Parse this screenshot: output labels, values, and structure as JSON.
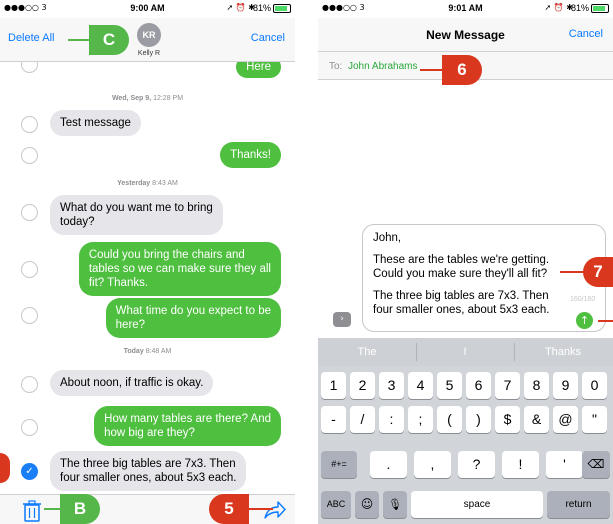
{
  "left": {
    "status": {
      "carrier": "●●●○○ 3",
      "time": "9:00 AM",
      "icons": "➚ ⏰ ✱",
      "battery": "81%"
    },
    "header": {
      "delete_all": "Delete All",
      "avatar_initials": "KR",
      "contact_name": "Kelly R",
      "cancel": "Cancel"
    },
    "messages": [
      {
        "text": "Here"
      },
      {
        "stamp_day": "Wed, Sep 9,",
        "stamp_time": "12:28 PM"
      },
      {
        "text": "Test message"
      },
      {
        "text": "Thanks!"
      },
      {
        "stamp_day": "Yesterday",
        "stamp_time": "8:43 AM"
      },
      {
        "line1": "What do you want me to bring",
        "line2": "today?"
      },
      {
        "line1": "Could you bring the chairs and",
        "line2": "tables so we can make sure they all",
        "line3": "fit? Thanks."
      },
      {
        "line1": "What time do you expect to be",
        "line2": "here?"
      },
      {
        "stamp_day": "Today",
        "stamp_time": "8:48 AM"
      },
      {
        "text": "About noon, if traffic is okay."
      },
      {
        "line1": "How many tables are there? And",
        "line2": "how big are they?"
      },
      {
        "line1": "The three big tables are 7x3. Then",
        "line2": "four smaller ones, about 5x3 each."
      }
    ],
    "callouts": {
      "c": "C",
      "b": "B",
      "five": "5"
    }
  },
  "right": {
    "status": {
      "carrier": "●●●○○ 3",
      "time": "9:01 AM",
      "icons": "➚ ⏰ ✱",
      "battery": "81%"
    },
    "header": {
      "title": "New Message",
      "cancel": "Cancel"
    },
    "to": {
      "label": "To:",
      "recipient": "John Abrahams"
    },
    "compose": {
      "greeting": "John,",
      "para1_line1": "These are the tables we're getting.",
      "para1_line2": "Could you make sure they'll all fit?",
      "para2_line1": "The three big tables are 7x3. Then",
      "para2_line2": "four smaller ones, about 5x3 each.",
      "char_count": "160/160"
    },
    "suggestions": [
      "The",
      "I",
      "Thanks"
    ],
    "keys": {
      "row1": [
        "1",
        "2",
        "3",
        "4",
        "5",
        "6",
        "7",
        "8",
        "9",
        "0"
      ],
      "row2": [
        "-",
        "/",
        ":",
        ";",
        "(",
        ")",
        "$",
        "&",
        "@",
        "\""
      ],
      "row3_left": "#+=",
      "row3": [
        ".",
        ",",
        "?",
        "!",
        "'"
      ],
      "row4_left": "ABC",
      "space": "space",
      "return": "return"
    },
    "callouts": {
      "six": "6",
      "seven": "7"
    }
  },
  "colors": {
    "imessage_green": "#4fbf3f",
    "ios_blue": "#0a7aff",
    "callout_green": "#55b64a",
    "callout_red": "#d9381e"
  },
  "icons": [
    "trash-icon",
    "forward-icon",
    "checkmark-icon",
    "send-arrow-icon",
    "chevron-right-icon",
    "emoji-icon",
    "microphone-icon",
    "delete-key-icon"
  ]
}
